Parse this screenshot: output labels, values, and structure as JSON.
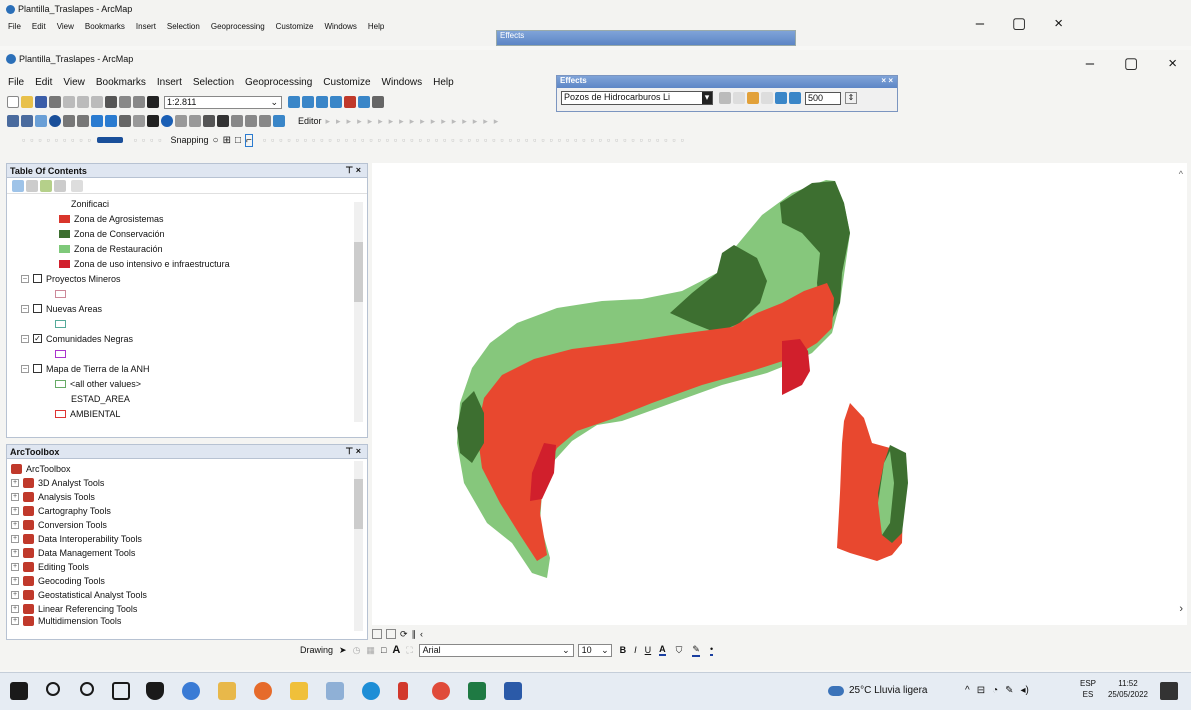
{
  "back_window": {
    "title": "Plantilla_Traslapes - ArcMap",
    "menu": [
      "File",
      "Edit",
      "View",
      "Bookmarks",
      "Insert",
      "Selection",
      "Geoprocessing",
      "Customize",
      "Windows",
      "Help"
    ],
    "effects_title": "Effects"
  },
  "window": {
    "title": "Plantilla_Traslapes - ArcMap",
    "menu": [
      "File",
      "Edit",
      "View",
      "Bookmarks",
      "Insert",
      "Selection",
      "Geoprocessing",
      "Customize",
      "Windows",
      "Help"
    ],
    "scale": "1:2.811",
    "editor_label": "Editor",
    "snapping_label": "Snapping"
  },
  "effects": {
    "title": "Effects",
    "layer": "Pozos de Hidrocarburos Li",
    "value": "500"
  },
  "toc": {
    "title": "Table Of Contents",
    "group_label": "Zonificaci",
    "legend": [
      {
        "label": "Zona de Agrosistemas",
        "color": "#d9352b"
      },
      {
        "label": "Zona de Conservación",
        "color": "#3c6e2f"
      },
      {
        "label": "Zona de Restauración",
        "color": "#7fc97a"
      },
      {
        "label": "Zona de uso intensivo e infraestructura",
        "color": "#d11f2c"
      }
    ],
    "layers": [
      {
        "label": "Proyectos Mineros",
        "checked": false
      },
      {
        "label": "Nuevas Areas",
        "checked": false
      },
      {
        "label": "Comunidades Negras",
        "checked": true
      },
      {
        "label": "Mapa de Tierra de la ANH",
        "checked": false
      }
    ],
    "sub_all_other": "<all other values>",
    "sub_field": "ESTAD_AREA",
    "sub_value": "AMBIENTAL"
  },
  "toolbox": {
    "title": "ArcToolbox",
    "root": "ArcToolbox",
    "tools": [
      "3D Analyst Tools",
      "Analysis Tools",
      "Cartography Tools",
      "Conversion Tools",
      "Data Interoperability Tools",
      "Data Management Tools",
      "Editing Tools",
      "Geocoding Tools",
      "Geostatistical Analyst Tools",
      "Linear Referencing Tools",
      "Multidimension Tools"
    ]
  },
  "drawing_toolbar": {
    "label": "Drawing",
    "font": "Arial",
    "size": "10",
    "bold": "B",
    "italic": "I",
    "underline": "U"
  },
  "taskbar": {
    "weather": "25°C Lluvia ligera",
    "lang": "ESP",
    "lang_sub": "ES",
    "time": "11:52",
    "date": "25/05/2022"
  },
  "win_controls": {
    "minimize": "–",
    "maximize": "▢",
    "close": "×"
  },
  "colors": {
    "agro": "#e8482f",
    "conservacion": "#3c6e2f",
    "restauracion": "#86c77c",
    "intensivo": "#d11f2c",
    "taskbar": "#e6ecf3"
  }
}
